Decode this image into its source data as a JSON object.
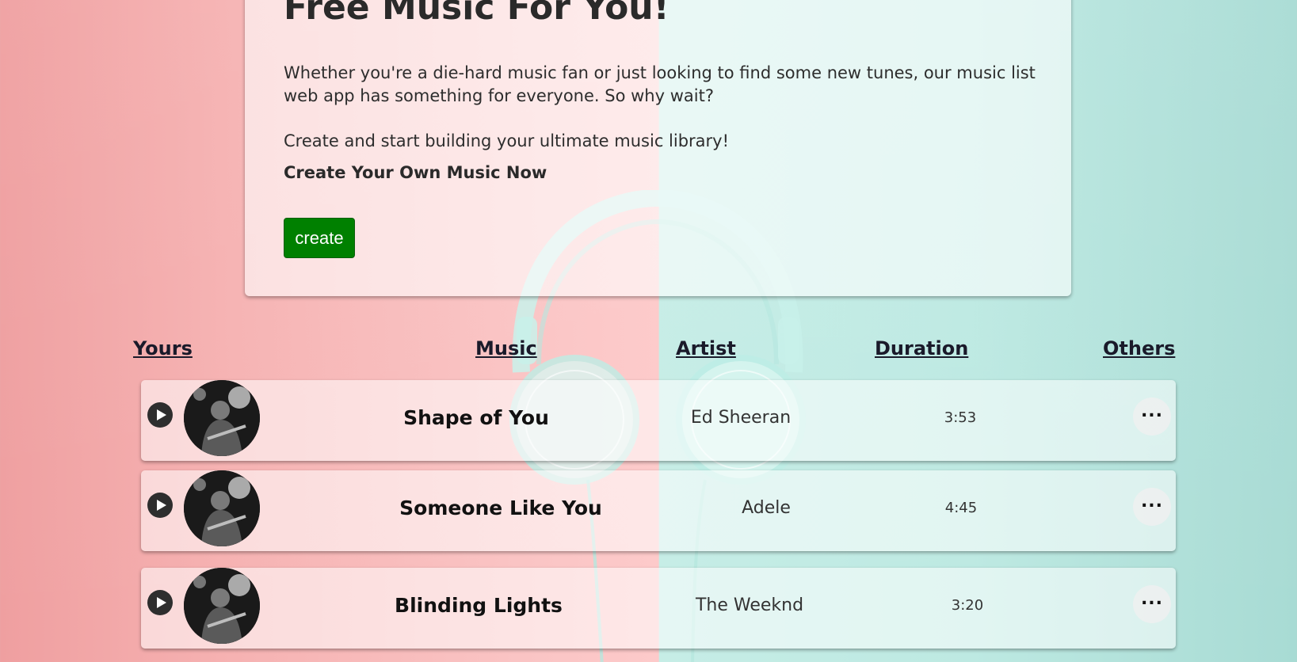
{
  "hero": {
    "title": "Free Music For You!",
    "paragraph1": "Whether you're a die-hard music fan or just looking to find some new tunes, our music list web app has something for everyone. So why wait?",
    "paragraph2": "Create and start building your ultimate music library!",
    "subheading": "Create Your Own Music Now",
    "create_label": "create"
  },
  "columns": {
    "yours": "Yours",
    "music": "Music",
    "artist": "Artist",
    "duration": "Duration",
    "others": "Others"
  },
  "tracks": [
    {
      "title": "Shape of You",
      "artist": "Ed Sheeran",
      "duration": "3:53",
      "more_label": "..."
    },
    {
      "title": "Someone Like You",
      "artist": "Adele",
      "duration": "4:45",
      "more_label": "..."
    },
    {
      "title": "Blinding Lights",
      "artist": "The Weeknd",
      "duration": "3:20",
      "more_label": "..."
    }
  ],
  "colors": {
    "create_button": "#008000",
    "background_left": "#f6b2b2",
    "background_right": "#bde9e2",
    "headphones": "#bdeee6"
  },
  "icons": {
    "play": "play-icon",
    "more": "more-horizontal-icon",
    "avatar": "artist-photo"
  }
}
